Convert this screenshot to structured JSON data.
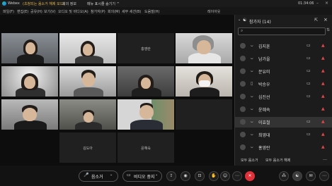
{
  "titlebar": {
    "app_name": "Webex",
    "notice": "(초청되는 음소거 해제 모드)",
    "meeting_info": "회의 정보",
    "hide_menu": "메뉴 표시줄 숨기기 ^",
    "time": "01:34:06"
  },
  "menubar": {
    "items": [
      "파일(F)",
      "편집(E)",
      "공유(H)",
      "보기(V)",
      "오디오 및 비디오(A)",
      "참가자(P)",
      "회의(M)",
      "세부 세션(B)",
      "도움말(H)"
    ],
    "layout_label": "레이아웃"
  },
  "tiles": {
    "t4_name": "홍영란",
    "t12_name": "김도아",
    "t13_name": "윤혜숙"
  },
  "panel": {
    "title": "참가자 (14)",
    "participants": [
      {
        "name": "김지훈",
        "mic": "ᴗ",
        "camera": "▭",
        "muted": "▲"
      },
      {
        "name": "남가을",
        "mic": "ᴗ",
        "camera": "▭",
        "muted": "▲"
      },
      {
        "name": "문유미",
        "mic": "ᴗ",
        "camera": "▭",
        "muted": "▲"
      },
      {
        "name": "박승우",
        "mic": "▯",
        "camera": "▭",
        "muted": "▲"
      },
      {
        "name": "심진선",
        "mic": "ᴗ",
        "camera": "▭",
        "muted": "▲"
      },
      {
        "name": "윤혜숙",
        "mic": "ᴗ",
        "camera": "",
        "muted": "▲"
      },
      {
        "name": "이효철",
        "mic": "ᴗ",
        "camera": "▭",
        "muted": "▲"
      },
      {
        "name": "최영대",
        "mic": "ᴗ",
        "camera": "▭",
        "muted": "▲"
      },
      {
        "name": "홍영란",
        "mic": "ᴗ",
        "camera": "",
        "muted": "▲"
      }
    ],
    "mute_all": "모두 음소거",
    "unmute_all": "모두 음소거 해제"
  },
  "controls": {
    "mute_label": "음소거",
    "video_label": "비디오 중지"
  },
  "colors": {
    "accent_red": "#e04646",
    "end_red": "#e0313a",
    "brand": "#23c3a4"
  }
}
